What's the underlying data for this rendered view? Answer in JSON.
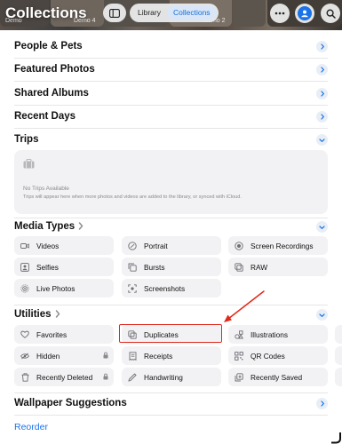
{
  "header": {
    "title": "Collections",
    "thumb_labels": [
      "Demo",
      "Demo 4",
      "Demo 2"
    ],
    "view_tabs": [
      {
        "label": "Library",
        "active": false
      },
      {
        "label": "Collections",
        "active": true
      }
    ]
  },
  "sections": {
    "people_pets": "People & Pets",
    "featured_photos": "Featured Photos",
    "shared_albums": "Shared Albums",
    "recent_days": "Recent Days",
    "trips": "Trips",
    "media_types": "Media Types",
    "utilities": "Utilities",
    "wallpaper": "Wallpaper Suggestions"
  },
  "trips_card": {
    "heading": "No Trips Available",
    "subtitle": "Trips will appear here when more photos and videos are added to the library, or synced with iCloud."
  },
  "media_types": [
    {
      "label": "Videos",
      "icon": "video-icon"
    },
    {
      "label": "Portrait",
      "icon": "portrait-icon"
    },
    {
      "label": "Screen Recordings",
      "icon": "screen-recording-icon"
    },
    {
      "label": "Selfies",
      "icon": "selfie-icon"
    },
    {
      "label": "Bursts",
      "icon": "bursts-icon"
    },
    {
      "label": "RAW",
      "icon": "raw-icon"
    },
    {
      "label": "Live Photos",
      "icon": "live-photo-icon"
    },
    {
      "label": "Screenshots",
      "icon": "screenshot-icon"
    }
  ],
  "utilities": [
    {
      "label": "Favorites",
      "icon": "heart-icon",
      "locked": false
    },
    {
      "label": "Duplicates",
      "icon": "duplicates-icon",
      "locked": false
    },
    {
      "label": "Illustrations",
      "icon": "illustrations-icon",
      "locked": false
    },
    {
      "label": "Hidden",
      "icon": "eye-slash-icon",
      "locked": true
    },
    {
      "label": "Receipts",
      "icon": "receipt-icon",
      "locked": false
    },
    {
      "label": "QR Codes",
      "icon": "qr-code-icon",
      "locked": false
    },
    {
      "label": "Recently Deleted",
      "icon": "trash-icon",
      "locked": true
    },
    {
      "label": "Handwriting",
      "icon": "pencil-icon",
      "locked": false
    },
    {
      "label": "Recently Saved",
      "icon": "recently-saved-icon",
      "locked": false
    }
  ],
  "footer": {
    "reorder": "Reorder"
  },
  "colors": {
    "accent": "#1a73e8",
    "annotation": "#e0291b",
    "tile_bg": "#f2f2f4"
  }
}
